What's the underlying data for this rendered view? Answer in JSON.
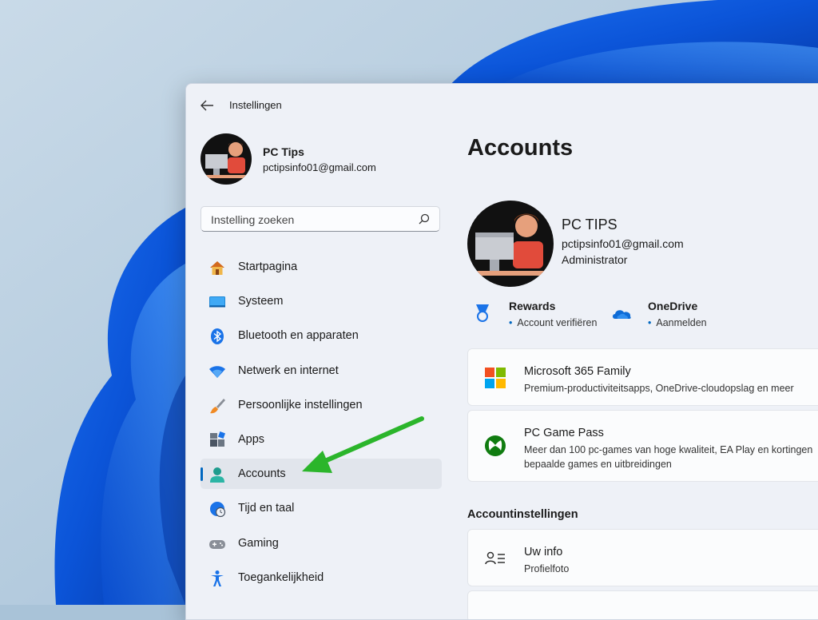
{
  "window": {
    "title": "Instellingen"
  },
  "profile": {
    "name": "PC Tips",
    "email": "pctipsinfo01@gmail.com"
  },
  "search": {
    "placeholder": "Instelling zoeken"
  },
  "nav": {
    "items": [
      {
        "label": "Startpagina",
        "icon": "home-icon"
      },
      {
        "label": "Systeem",
        "icon": "system-icon"
      },
      {
        "label": "Bluetooth en apparaten",
        "icon": "bluetooth-icon"
      },
      {
        "label": "Netwerk en internet",
        "icon": "wifi-icon"
      },
      {
        "label": "Persoonlijke instellingen",
        "icon": "brush-icon"
      },
      {
        "label": "Apps",
        "icon": "apps-icon"
      },
      {
        "label": "Accounts",
        "icon": "account-icon",
        "active": true
      },
      {
        "label": "Tijd en taal",
        "icon": "clock-globe-icon"
      },
      {
        "label": "Gaming",
        "icon": "gamepad-icon"
      },
      {
        "label": "Toegankelijkheid",
        "icon": "accessibility-icon"
      }
    ]
  },
  "main": {
    "title": "Accounts",
    "account": {
      "name": "PC TIPS",
      "email": "pctipsinfo01@gmail.com",
      "role": "Administrator"
    },
    "services": [
      {
        "title": "Rewards",
        "subtitle": "Account verifiëren",
        "icon": "rewards-medal-icon"
      },
      {
        "title": "OneDrive",
        "subtitle": "Aanmelden",
        "icon": "onedrive-cloud-icon"
      }
    ],
    "cards": [
      {
        "title": "Microsoft 365 Family",
        "description": "Premium-productiviteitsapps, OneDrive-cloudopslag en meer",
        "icon": "microsoft-logo-icon"
      },
      {
        "title": "PC Game Pass",
        "description_line1": "Meer dan 100 pc-games van hoge kwaliteit, EA Play en kortingen",
        "description_line2": "bepaalde games en uitbreidingen",
        "icon": "xbox-icon"
      }
    ],
    "section": "Accountinstellingen",
    "settings": [
      {
        "title": "Uw info",
        "subtitle": "Profielfoto",
        "icon": "user-info-icon"
      }
    ]
  },
  "colors": {
    "accent": "#0067c0",
    "annotation_arrow": "#2bb52b"
  }
}
